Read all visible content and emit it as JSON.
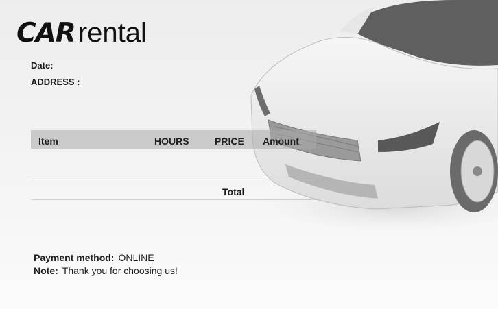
{
  "brand": {
    "logo_bold": "CAR",
    "logo_light": "rental"
  },
  "meta": {
    "date_label": "Date:",
    "address_label": "ADDRESS :"
  },
  "table": {
    "columns": [
      "Item",
      "HOURS",
      "PRICE",
      "Amount"
    ],
    "total_label": "Total"
  },
  "footer": {
    "payment_label": "Payment method:",
    "payment_value": "ONLINE",
    "note_label": "Note:",
    "note_value": "Thank you for choosing us!"
  },
  "colors": {
    "header_bg": "#aaaaaa",
    "text": "#1c1c1c",
    "background": "#f1f1f1"
  }
}
